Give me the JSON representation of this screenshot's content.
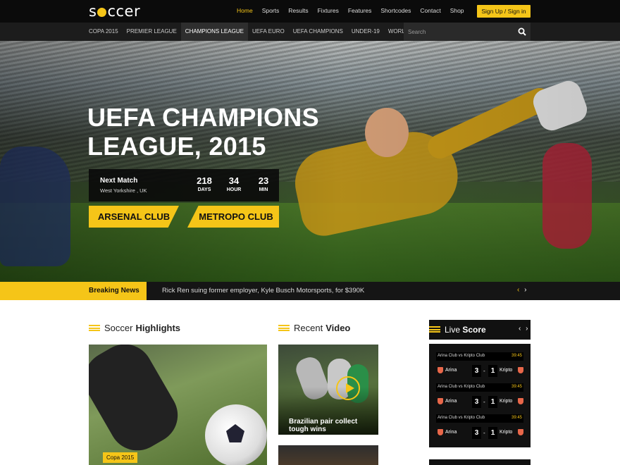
{
  "brand": {
    "logo_pre": "s",
    "logo_post": "ccer"
  },
  "nav": {
    "items": [
      "Home",
      "Sports",
      "Results",
      "Fixtures",
      "Features",
      "Shortcodes",
      "Contact",
      "Shop"
    ],
    "active": "Home",
    "signup": "Sign Up / Sign in"
  },
  "categories": [
    "COPA 2015",
    "PREMIER LEAGUE",
    "CHAMPIONS LEAGUE",
    "UEFA EURO",
    "UEFA CHAMPIONS",
    "UNDER-19",
    "WORLD CUP"
  ],
  "search": {
    "placeholder": "Search"
  },
  "hero": {
    "title_line1": "UEFA CHAMPIONS",
    "title_line2": "LEAGUE, 2015",
    "next_match_label": "Next Match",
    "location": "West Yorkshire , UK",
    "countdown": [
      {
        "value": "218",
        "unit": "DAYS"
      },
      {
        "value": "34",
        "unit": "HOUR"
      },
      {
        "value": "23",
        "unit": "MIN"
      }
    ],
    "team_a": "ARSENAL CLUB",
    "team_b": "METROPO CLUB"
  },
  "breaking": {
    "label": "Breaking News",
    "text": "Rick Ren suing former employer, Kyle Busch Motorsports, for $390K",
    "prev": "‹",
    "next": "›"
  },
  "highlights": {
    "title_plain": "Soccer",
    "title_bold": "Highlights",
    "tag": "Copa 2015"
  },
  "recent_video": {
    "title_plain": "Recent",
    "title_bold": "Video",
    "caption": "Brazilian pair collect tough wins"
  },
  "live_score": {
    "title_plain": "Live",
    "title_bold": "Score",
    "prev": "‹",
    "next": "›",
    "matches": [
      {
        "name": "Arina Club vs Kripto Club",
        "time": "39:45",
        "home": "Arina",
        "away": "Kripto",
        "home_score": "3",
        "away_score": "1"
      },
      {
        "name": "Arina Club vs Kripto Club",
        "time": "39:45",
        "home": "Arina",
        "away": "Kripto",
        "home_score": "3",
        "away_score": "1"
      },
      {
        "name": "Arina Club vs Kripto Club",
        "time": "39:45",
        "home": "Arina",
        "away": "Kripto",
        "home_score": "3",
        "away_score": "1"
      }
    ]
  },
  "colors": {
    "accent": "#f5c518",
    "dark": "#111111"
  }
}
